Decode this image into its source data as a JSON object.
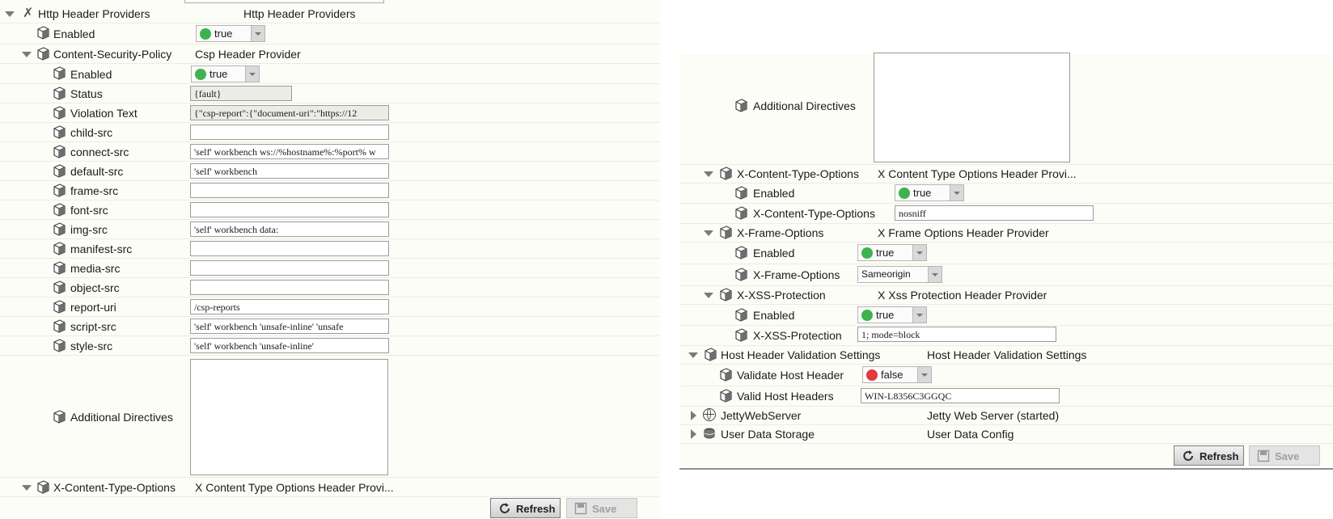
{
  "colors": {
    "true_dot": "#3fb24f",
    "false_dot": "#e23b3b",
    "panel_bg": "#fdfdf7"
  },
  "left": {
    "http_header_providers": {
      "label": "Http Header Providers",
      "value": "Http Header Providers"
    },
    "enabled": {
      "label": "Enabled",
      "value": "true"
    },
    "csp": {
      "label": "Content-Security-Policy",
      "value": "Csp Header Provider"
    },
    "csp_enabled": {
      "label": "Enabled",
      "value": "true"
    },
    "status": {
      "label": "Status",
      "value": "{fault}"
    },
    "violation_text": {
      "label": "Violation Text",
      "value": "{\"csp-report\":{\"document-uri\":\"https://12"
    },
    "child_src": {
      "label": "child-src",
      "value": ""
    },
    "connect_src": {
      "label": "connect-src",
      "value": "'self' workbench ws://%hostname%:%port% w"
    },
    "default_src": {
      "label": "default-src",
      "value": "'self' workbench"
    },
    "frame_src": {
      "label": "frame-src",
      "value": ""
    },
    "font_src": {
      "label": "font-src",
      "value": ""
    },
    "img_src": {
      "label": "img-src",
      "value": "'self' workbench data:"
    },
    "manifest_src": {
      "label": "manifest-src",
      "value": ""
    },
    "media_src": {
      "label": "media-src",
      "value": ""
    },
    "object_src": {
      "label": "object-src",
      "value": ""
    },
    "report_uri": {
      "label": "report-uri",
      "value": "/csp-reports"
    },
    "script_src": {
      "label": "script-src",
      "value": "'self' workbench 'unsafe-inline' 'unsafe"
    },
    "style_src": {
      "label": "style-src",
      "value": "'self' workbench 'unsafe-inline'"
    },
    "additional_directives": {
      "label": "Additional Directives",
      "value": ""
    },
    "x_content_type_options": {
      "label": "X-Content-Type-Options",
      "value": "X Content Type Options Header Provi..."
    },
    "refresh": "Refresh",
    "save": "Save"
  },
  "right": {
    "additional_directives": {
      "label": "Additional Directives"
    },
    "x_content_type_options": {
      "label": "X-Content-Type-Options",
      "value": "X Content Type Options Header Provi..."
    },
    "xcto_enabled": {
      "label": "Enabled",
      "value": "true"
    },
    "xcto_field": {
      "label": "X-Content-Type-Options",
      "value": "nosniff"
    },
    "x_frame_options": {
      "label": "X-Frame-Options",
      "value": "X Frame Options Header Provider"
    },
    "xfo_enabled": {
      "label": "Enabled",
      "value": "true"
    },
    "xfo_field": {
      "label": "X-Frame-Options",
      "value": "Sameorigin"
    },
    "x_xss_protection": {
      "label": "X-XSS-Protection",
      "value": "X Xss Protection Header Provider"
    },
    "xxss_enabled": {
      "label": "Enabled",
      "value": "true"
    },
    "xxss_field": {
      "label": "X-XSS-Protection",
      "value": "1; mode=block"
    },
    "host_header": {
      "label": "Host Header Validation Settings",
      "value": "Host Header Validation Settings"
    },
    "validate_host": {
      "label": "Validate Host Header",
      "value": "false"
    },
    "valid_hosts": {
      "label": "Valid Host Headers",
      "value": "WIN-L8356C3GGQC"
    },
    "jetty": {
      "label": "JettyWebServer",
      "value": "Jetty Web Server (started)"
    },
    "user_data": {
      "label": "User Data Storage",
      "value": "User Data Config"
    },
    "refresh": "Refresh",
    "save": "Save"
  }
}
